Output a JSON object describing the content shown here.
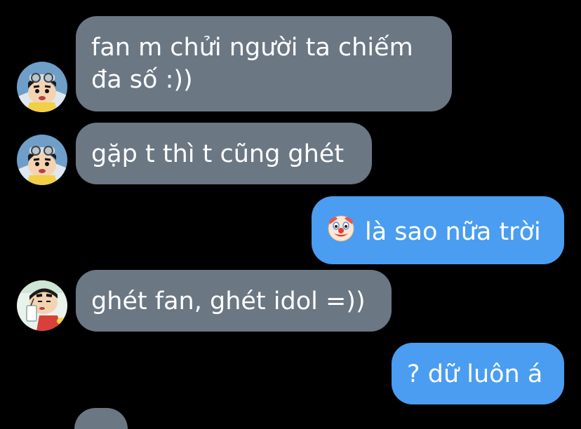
{
  "conversation": {
    "messages": [
      {
        "direction": "incoming",
        "sender_avatar": "crayon-shin-chan-avatar-goggles",
        "text_line1": "fan m chửi người ta chiếm",
        "text_line2": "đa số :))"
      },
      {
        "direction": "incoming",
        "sender_avatar": "crayon-shin-chan-avatar-goggles",
        "text": "gặp t thì t cũng ghét"
      },
      {
        "direction": "outgoing",
        "emoji": "clown-face-icon",
        "text": "là sao nữa trời"
      },
      {
        "direction": "incoming",
        "sender_avatar": "crayon-shin-chan-avatar-drinking",
        "text": "ghét fan, ghét idol =))"
      },
      {
        "direction": "outgoing",
        "text": "? dữ luôn á"
      }
    ]
  },
  "colors": {
    "background": "#000000",
    "incoming_bubble": "#6b7783",
    "outgoing_bubble": "#4a9df0",
    "text": "#ffffff"
  }
}
